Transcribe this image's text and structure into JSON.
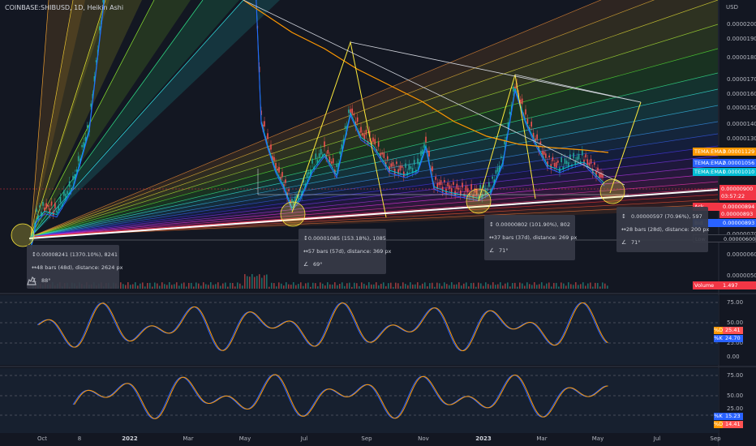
{
  "header": {
    "title": "COINBASE:SHIBUSD, 1D, Heikin Ashi",
    "currency": "USD"
  },
  "price_axis": [
    "0.00002000",
    "0.00001900",
    "0.00001800",
    "0.00001700",
    "0.00001600",
    "0.00001500",
    "0.00001400",
    "0.00001300",
    "0.00001200",
    "0.00000900",
    "0.00000800",
    "0.00000700",
    "0.00000600",
    "0.00000500"
  ],
  "price_badges": [
    {
      "key": "TEMA:EMA3",
      "value": "0.00001129",
      "color": "#ff9800"
    },
    {
      "key": "TEMA:EMA2",
      "value": "0.00001056",
      "color": "#2962ff"
    },
    {
      "key": "TEMA:EMA1",
      "value": "0.00001010",
      "color": "#00bcd4"
    },
    {
      "key": "",
      "value": "0.00000900",
      "color": "#f23645"
    },
    {
      "key": "",
      "value": "03:57:22",
      "color": "#f23645"
    },
    {
      "key": "Ask",
      "value": "0.00000894",
      "color": "#f23645"
    },
    {
      "key": "",
      "value": "0.00000893",
      "color": "#f23645"
    },
    {
      "key": "Bid",
      "value": "0.00000893",
      "color": "#2962ff"
    },
    {
      "key": "Low",
      "value": "0.00000600",
      "color": "#131722"
    },
    {
      "key": "Volume",
      "value": "1.497",
      "color": "#f23645"
    }
  ],
  "measurements": [
    {
      "price": "0.00008241 (1370.10%), 8241",
      "bars": "48 bars (48d), distance: 2624 px",
      "angle": "88°"
    },
    {
      "price": "0.00001085 (153.18%), 1085",
      "bars": "57 bars (57d), distance: 369 px",
      "angle": "69°"
    },
    {
      "price": "0.00000802 (101.90%), 802",
      "bars": "37 bars (37d), distance: 269 px",
      "angle": "71°"
    },
    {
      "price": "0.00000597 (70.96%), 597",
      "bars": "28 bars (28d), distance: 200 px",
      "angle": "71°"
    }
  ],
  "osc1": {
    "ticks": [
      "75.00",
      "50.00",
      "25.00",
      "0.00"
    ],
    "k_label": "%D",
    "k_value": "25.41",
    "d_label": "%K",
    "d_value": "24.70"
  },
  "osc2": {
    "ticks": [
      "75.00",
      "50.00",
      "25.00"
    ],
    "k_label": "%K",
    "k_value": "15.23",
    "d_label": "%D",
    "d_value": "14.41"
  },
  "time_axis": [
    {
      "label": "Oct",
      "bold": false
    },
    {
      "label": "8",
      "bold": false
    },
    {
      "label": "2022",
      "bold": true
    },
    {
      "label": "Mar",
      "bold": false
    },
    {
      "label": "May",
      "bold": false
    },
    {
      "label": "Jul",
      "bold": false
    },
    {
      "label": "Sep",
      "bold": false
    },
    {
      "label": "Nov",
      "bold": false
    },
    {
      "label": "2023",
      "bold": true
    },
    {
      "label": "Mar",
      "bold": false
    },
    {
      "label": "May",
      "bold": false
    },
    {
      "label": "Jul",
      "bold": false
    },
    {
      "label": "Sep",
      "bold": false
    }
  ],
  "colors": {
    "background": "#131722",
    "up": "#26a69a",
    "down": "#ef5350",
    "ema_orange": "#ff9800",
    "ema_blue": "#2962ff",
    "ema_cyan": "#00bcd4",
    "pattern_yellow": "#ffeb3b",
    "trend_white": "#ffffff"
  }
}
